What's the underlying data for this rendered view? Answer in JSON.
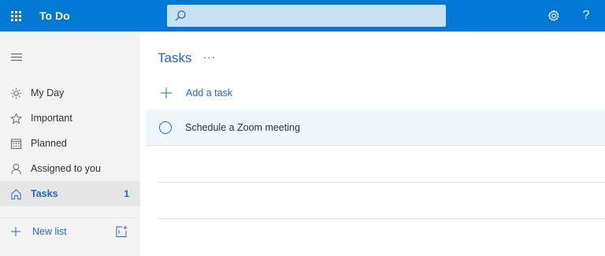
{
  "app": {
    "title": "To Do"
  },
  "search": {
    "placeholder": "",
    "value": ""
  },
  "header_icons": {
    "settings": "gear-icon",
    "help": "?"
  },
  "sidebar": {
    "items": [
      {
        "label": "My Day",
        "icon": "sun-icon"
      },
      {
        "label": "Important",
        "icon": "star-icon"
      },
      {
        "label": "Planned",
        "icon": "calendar-icon"
      },
      {
        "label": "Assigned to you",
        "icon": "person-icon"
      },
      {
        "label": "Tasks",
        "icon": "home-icon",
        "count": "1"
      }
    ],
    "new_list_label": "New list"
  },
  "main": {
    "list_title": "Tasks",
    "more_label": "···",
    "add_task_label": "Add a task",
    "tasks": [
      {
        "title": "Schedule a Zoom meeting"
      }
    ]
  },
  "colors": {
    "header": "#0078d4",
    "accent": "#2564cf",
    "sidebar_bg": "#f4f4f4",
    "selected_row": "#eff6fc"
  }
}
